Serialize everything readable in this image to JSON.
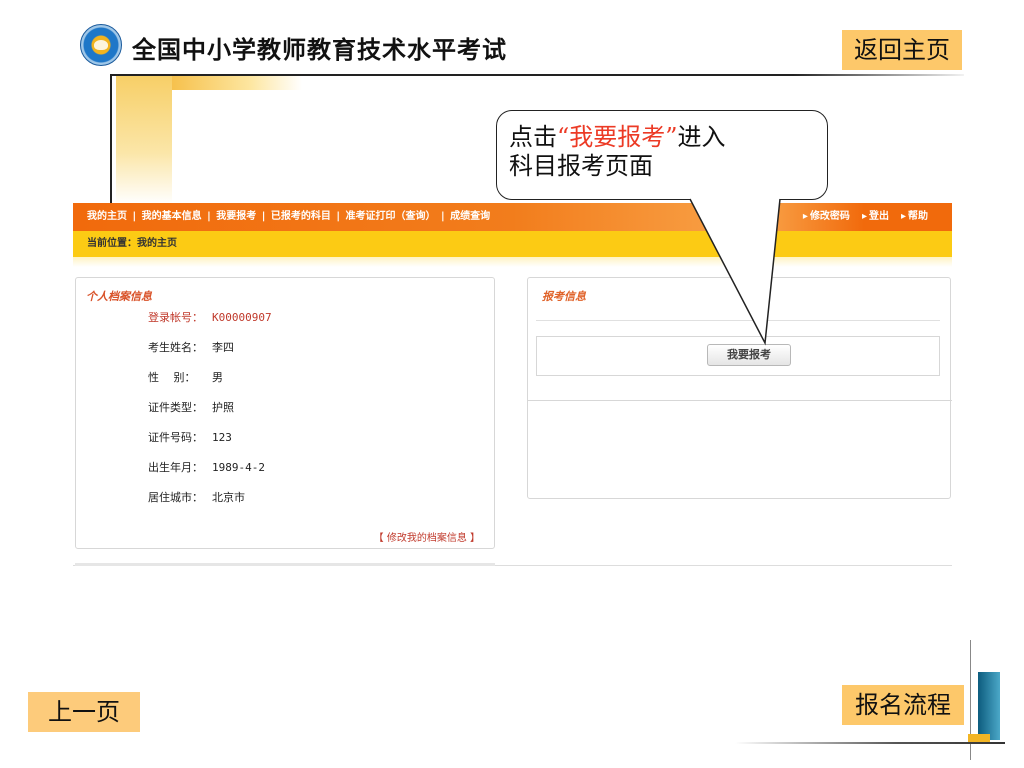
{
  "header": {
    "title": "全国中小学教师教育技术水平考试",
    "logo_icon": "exam-seal-logo-icon",
    "home_button": "返回主页"
  },
  "callout": {
    "prefix": "点击",
    "highlight": "“我要报考”",
    "suffix": "进入",
    "line2": "科目报考页面",
    "highlight_color": "#ec3a25"
  },
  "web": {
    "nav_items": [
      "我的主页",
      "我的基本信息",
      "我要报考",
      "已报考的科目",
      "准考证打印（查询）",
      "成绩查询"
    ],
    "nav_right": [
      "修改密码",
      "登出",
      "帮助"
    ],
    "breadcrumb": "当前位置：我的主页",
    "profile": {
      "title": "个人档案信息",
      "fields": [
        {
          "label": "登录帐号：",
          "value": "K00000907"
        },
        {
          "label": "考生姓名：",
          "value": "李四"
        },
        {
          "label": "性　 别：",
          "value": "男"
        },
        {
          "label": "证件类型：",
          "value": "护照"
        },
        {
          "label": "证件号码：",
          "value": "123"
        },
        {
          "label": "出生年月：",
          "value": "1989-4-2"
        },
        {
          "label": "居住城市：",
          "value": "北京市"
        }
      ],
      "edit_link": "【 修改我的档案信息 】"
    },
    "exam": {
      "title": "报考信息",
      "apply_button": "我要报考"
    }
  },
  "footer": {
    "prev_button": "上一页",
    "flow_button": "报名流程"
  },
  "colors": {
    "nav_orange": "#f16a0c",
    "breadcrumb_yellow": "#fccb14",
    "slide_button": "#fdc86a"
  }
}
